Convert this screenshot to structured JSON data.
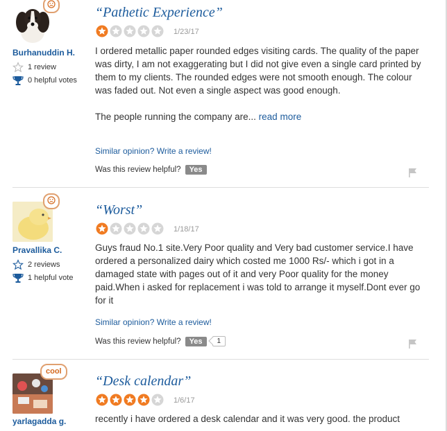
{
  "colors": {
    "link": "#1c5b9c",
    "star_filled": "#f07b22",
    "star_empty": "#d6d6d6",
    "badge_border": "#e0a070"
  },
  "reviews": [
    {
      "user": "Burhanuddin H.",
      "badge": "sad-face-icon",
      "reviews_count": "1 review",
      "helpful_votes": "0 helpful votes",
      "title": "“Pathetic Experience”",
      "rating": 1,
      "date": "1/23/17",
      "body1": "I ordered metallic paper rounded edges visiting cards. The quality of the paper was dirty, I am not exaggerating but I did not give even a single card printed by them to my clients. The rounded edges were not smooth enough. The colour was faded out. Not even a single aspect was good enough.",
      "body2": "The people running the company are...",
      "read_more": "read more",
      "similar": "Similar opinion? Write a review!",
      "helpful_q": "Was this review helpful?",
      "yes": "Yes"
    },
    {
      "user": "Pravallika C.",
      "badge": "sad-face-icon",
      "reviews_count": "2 reviews",
      "helpful_votes": "1 helpful vote",
      "title": "“Worst”",
      "rating": 1,
      "date": "1/18/17",
      "body1": "Guys fraud No.1 site.Very Poor quality and Very bad customer service.I have ordered a personalized dairy which costed me 1000 Rs/- which i got in a damaged state with pages out of it and very Poor quality for the money paid.When i asked for replacement i was told to arrange it myself.Dont ever go for it",
      "similar": "Similar opinion? Write a review!",
      "helpful_q": "Was this review helpful?",
      "yes": "Yes",
      "yes_count": "1"
    },
    {
      "user": "yarlagadda g.",
      "badge": "cool",
      "title": "“Desk calendar”",
      "rating": 4,
      "date": "1/6/17",
      "body1": "recently i have ordered a desk calendar and it was very good. the product"
    }
  ]
}
